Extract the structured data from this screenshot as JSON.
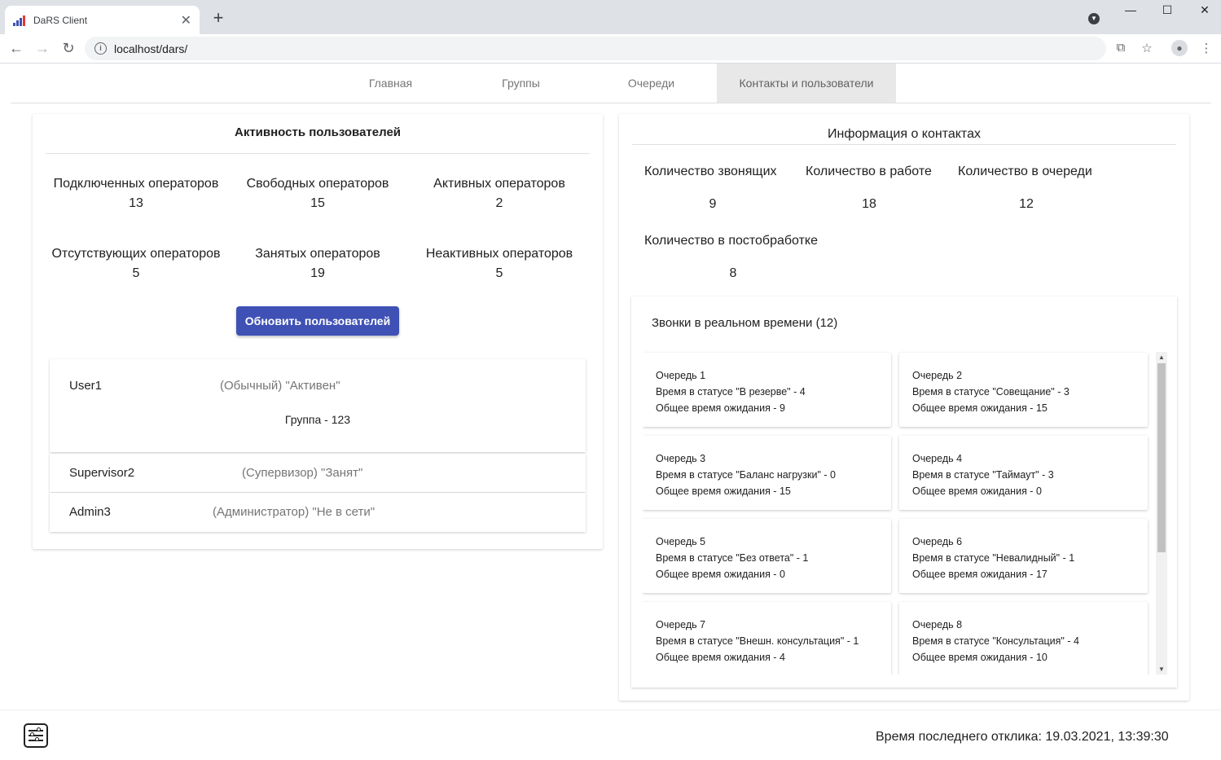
{
  "browser": {
    "tab_title": "DaRS Client",
    "tab_close": "✕",
    "new_tab": "+",
    "url": "localhost/dars/",
    "back": "←",
    "forward": "→",
    "reload": "↻",
    "minimize": "—",
    "maximize": "☐",
    "close": "✕"
  },
  "nav": {
    "tabs": [
      {
        "label": "Главная"
      },
      {
        "label": "Группы"
      },
      {
        "label": "Очереди"
      },
      {
        "label": "Контакты и пользователи",
        "active": true
      }
    ]
  },
  "users_activity": {
    "title": "Активность пользователей",
    "stats": [
      {
        "label": "Подключенных операторов",
        "value": "13"
      },
      {
        "label": "Свободных операторов",
        "value": "15"
      },
      {
        "label": "Активных операторов",
        "value": "2"
      },
      {
        "label": "Отсутствующих операторов",
        "value": "5"
      },
      {
        "label": "Занятых операторов",
        "value": "19"
      },
      {
        "label": "Неактивных операторов",
        "value": "5"
      }
    ],
    "update_button": "Обновить пользователей",
    "users": [
      {
        "name": "User1",
        "role_status": "(Обычный) \"Активен\"",
        "group": "Группа - 123"
      },
      {
        "name": "Supervisor2",
        "role_status": "(Супервизор) \"Занят\""
      },
      {
        "name": "Admin3",
        "role_status": "(Администратор) \"Не в сети\""
      }
    ]
  },
  "contacts_info": {
    "title": "Информация о контактах",
    "stats": [
      {
        "label": "Количество звонящих",
        "value": "9"
      },
      {
        "label": "Количество в работе",
        "value": "18"
      },
      {
        "label": "Количество в очереди",
        "value": "12"
      },
      {
        "label": "Количество в постобработке",
        "value": "8"
      }
    ],
    "realtime_title": "Звонки в реальном времени (12)",
    "queues": [
      {
        "name": "Очередь 1",
        "status": "Время в статусе \"В резерве\" - 4",
        "wait": "Общее время ожидания - 9"
      },
      {
        "name": "Очередь 2",
        "status": "Время в статусе \"Совещание\" - 3",
        "wait": "Общее время ожидания - 15"
      },
      {
        "name": "Очередь 3",
        "status": "Время в статусе \"Баланс нагрузки\" - 0",
        "wait": "Общее время ожидания - 15"
      },
      {
        "name": "Очередь 4",
        "status": "Время в статусе \"Таймаут\" - 3",
        "wait": "Общее время ожидания - 0"
      },
      {
        "name": "Очередь 5",
        "status": "Время в статусе \"Без ответа\" - 1",
        "wait": "Общее время ожидания - 0"
      },
      {
        "name": "Очередь 6",
        "status": "Время в статусе \"Невалидный\" - 1",
        "wait": "Общее время ожидания - 17"
      },
      {
        "name": "Очередь 7",
        "status": "Время в статусе \"Внешн. консультация\" - 1",
        "wait": "Общее время ожидания - 4"
      },
      {
        "name": "Очередь 8",
        "status": "Время в статусе \"Консультация\" - 4",
        "wait": "Общее время ожидания - 10"
      }
    ]
  },
  "footer": {
    "last_response": "Время последнего отклика: 19.03.2021, 13:39:30"
  },
  "colors": {
    "primary": "#3f51b5",
    "active_tab_bg": "#e8e8e8"
  }
}
